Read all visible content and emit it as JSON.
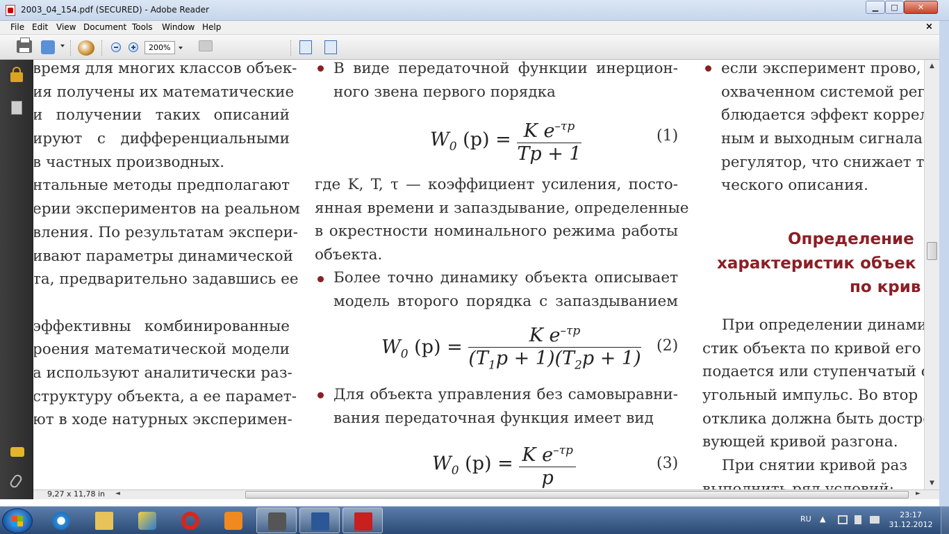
{
  "window": {
    "title": "2003_04_154.pdf (SECURED) - Adobe Reader",
    "buttons": {
      "minimize": "▁",
      "maximize": "□",
      "close": "✕"
    }
  },
  "menu": {
    "items": [
      "File",
      "Edit",
      "View",
      "Document",
      "Tools",
      "Window",
      "Help"
    ],
    "close_doc": "×"
  },
  "toolbar": {
    "zoom": "200%"
  },
  "document": {
    "col1": [
      "время для многих классов объек-",
      "ия получены их математические",
      "и получении таких описаний",
      "ируют с дифференциальными",
      "в частных производных.",
      "нтальные методы предполагают",
      "ерии экспериментов на реальном",
      "вления. По результатам экспери-",
      "ивают параметры динамической",
      "та, предварительно задавшись ее",
      "",
      "эффективны комбинированные",
      "роения математической модели",
      "а используют аналитически раз-",
      "структуру объекта, а ее парамет-",
      "ют в ходе натурных эксперимен-"
    ],
    "col2": {
      "b1_line1": "В виде передаточной функции инерцион-",
      "b1_line2": "ного звена первого порядка",
      "f1_lhs": "W",
      "f1_sub": "0",
      "f1_arg": " (p) =",
      "f1_num": "K e",
      "f1_sup": "–τp",
      "f1_den": "Tp + 1",
      "eq1": "(1)",
      "p1": [
        "где K, T, τ — коэффициент усиления, посто-",
        "янная времени и запаздывание, определенные",
        "в окрестности номинального режима работы",
        "объекта."
      ],
      "b2_line1": "Более точно динамику объекта описывает",
      "b2_line2": "модель второго порядка с запаздыванием",
      "f2_lhs": "W",
      "f2_sub": "0",
      "f2_arg": " (p) =",
      "f2_num": "K e",
      "f2_sup": "–τp",
      "f2_den_a": "(T",
      "f2_den_a_sub": "1",
      "f2_den_b": "p + 1)(T",
      "f2_den_b_sub": "2",
      "f2_den_c": "p + 1)",
      "eq2": "(2)",
      "b3_line1": "Для объекта управления без самовыравни-",
      "b3_line2": "вания передаточная функция имеет вид",
      "f3_lhs": "W",
      "f3_sub": "0",
      "f3_arg": " (p) =",
      "f3_num": "K e",
      "f3_sup": "–τp",
      "f3_den": "p",
      "eq3": "(3)"
    },
    "col3": {
      "lines_top": [
        "если эксперимент прово,",
        "охваченном системой регу",
        "блюдается эффект коррел",
        "ным и выходным сигнала",
        "регулятор, что снижает то",
        "ческого описания."
      ],
      "heading": [
        "Определение",
        "характеристик объек",
        "по крив"
      ],
      "lines_bottom": [
        "При определении динами",
        "стик объекта по кривой его",
        "подается или ступенчатый с",
        "угольный импульс. Во втор",
        "отклика должна быть достро",
        "вующей кривой разгона.",
        "При снятии кривой раз",
        "выполнить ряд условий:"
      ]
    }
  },
  "status": {
    "page_size": "9,27 x 11,78 in"
  },
  "taskbar": {
    "tray": {
      "lang": "RU",
      "time": "23:17",
      "date": "31.12.2012"
    }
  },
  "colors": {
    "accent": "#8b1f24",
    "text": "#333333"
  }
}
